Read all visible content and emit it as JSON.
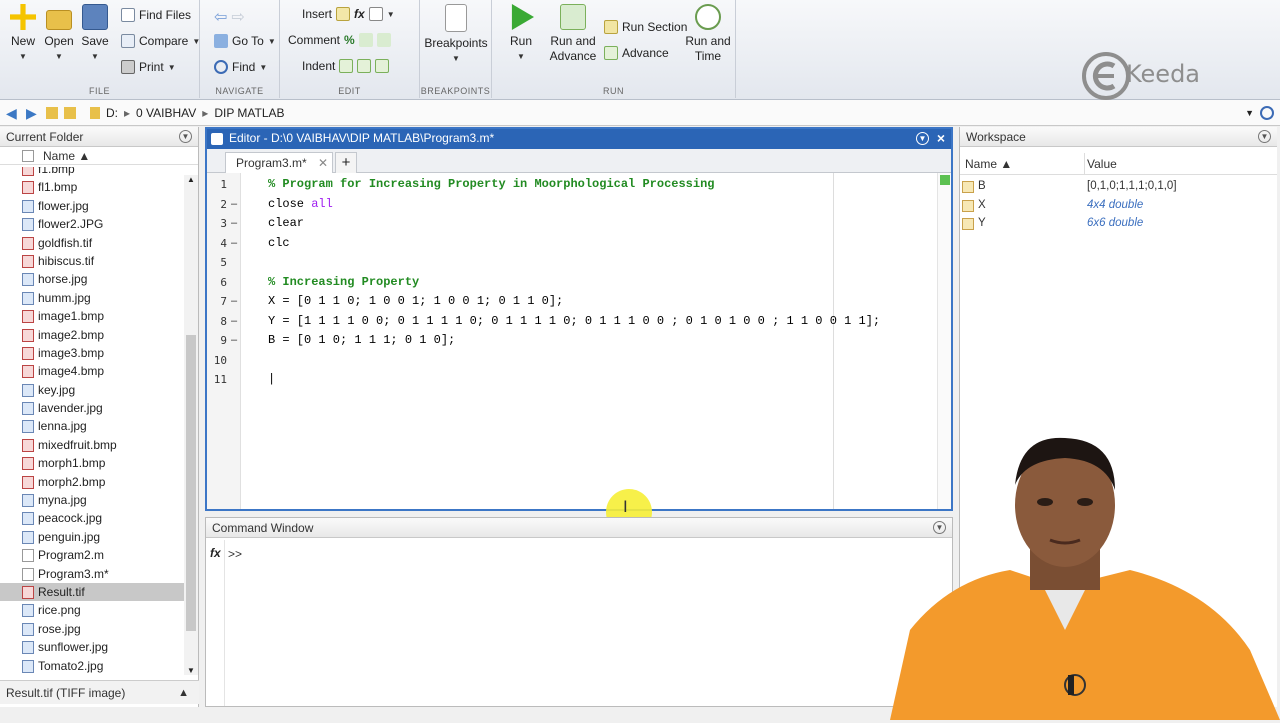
{
  "ribbon": {
    "file": {
      "new": "New",
      "open": "Open",
      "save": "Save",
      "find_files": "Find Files",
      "compare": "Compare",
      "print": "Print",
      "title": "FILE"
    },
    "navigate": {
      "go_to": "Go To",
      "find": "Find",
      "title": "NAVIGATE"
    },
    "edit": {
      "insert": "Insert",
      "comment": "Comment",
      "indent": "Indent",
      "title": "EDIT"
    },
    "breakpoints": {
      "label": "Breakpoints",
      "title": "BREAKPOINTS"
    },
    "run": {
      "run": "Run",
      "run_and_advance": "Run and\nAdvance",
      "run_section": "Run Section",
      "advance": "Advance",
      "run_and_time": "Run and\nTime",
      "title": "RUN"
    }
  },
  "address": {
    "crumbs": [
      "D:",
      "0 VAIBHAV",
      "DIP MATLAB"
    ]
  },
  "current_folder": {
    "title": "Current Folder",
    "column": "Name ▲",
    "files": [
      {
        "name": "f1.bmp",
        "type": "b"
      },
      {
        "name": "fl1.bmp",
        "type": "b"
      },
      {
        "name": "flower.jpg",
        "type": "i"
      },
      {
        "name": "flower2.JPG",
        "type": "i"
      },
      {
        "name": "goldfish.tif",
        "type": "b"
      },
      {
        "name": "hibiscus.tif",
        "type": "b"
      },
      {
        "name": "horse.jpg",
        "type": "i"
      },
      {
        "name": "humm.jpg",
        "type": "i"
      },
      {
        "name": "image1.bmp",
        "type": "b"
      },
      {
        "name": "image2.bmp",
        "type": "b"
      },
      {
        "name": "image3.bmp",
        "type": "b"
      },
      {
        "name": "image4.bmp",
        "type": "b"
      },
      {
        "name": "key.jpg",
        "type": "i"
      },
      {
        "name": "lavender.jpg",
        "type": "i"
      },
      {
        "name": "lenna.jpg",
        "type": "i"
      },
      {
        "name": "mixedfruit.bmp",
        "type": "b"
      },
      {
        "name": "morph1.bmp",
        "type": "b"
      },
      {
        "name": "morph2.bmp",
        "type": "b"
      },
      {
        "name": "myna.jpg",
        "type": "i"
      },
      {
        "name": "peacock.jpg",
        "type": "i"
      },
      {
        "name": "penguin.jpg",
        "type": "i"
      },
      {
        "name": "Program2.m",
        "type": "m"
      },
      {
        "name": "Program3.m*",
        "type": "m"
      },
      {
        "name": "Result.tif",
        "type": "b",
        "selected": true
      },
      {
        "name": "rice.png",
        "type": "i"
      },
      {
        "name": "rose.jpg",
        "type": "i"
      },
      {
        "name": "sunflower.jpg",
        "type": "i"
      },
      {
        "name": "Tomato2.jpg",
        "type": "i"
      }
    ],
    "status": "Result.tif (TIFF image)"
  },
  "editor": {
    "title": "Editor - D:\\0 VAIBHAV\\DIP MATLAB\\Program3.m*",
    "tab": "Program3.m*",
    "lines": [
      {
        "n": "1",
        "dash": false,
        "parts": [
          {
            "t": "% Program for Increasing Property in Moorphological Processing",
            "c": "cmt"
          }
        ]
      },
      {
        "n": "2",
        "dash": true,
        "parts": [
          {
            "t": "close ",
            "c": ""
          },
          {
            "t": "all",
            "c": "kw"
          }
        ]
      },
      {
        "n": "3",
        "dash": true,
        "parts": [
          {
            "t": "clear",
            "c": ""
          }
        ]
      },
      {
        "n": "4",
        "dash": true,
        "parts": [
          {
            "t": "clc",
            "c": ""
          }
        ]
      },
      {
        "n": "5",
        "dash": false,
        "parts": []
      },
      {
        "n": "6",
        "dash": false,
        "parts": [
          {
            "t": "% Increasing Property",
            "c": "cmt"
          }
        ]
      },
      {
        "n": "7",
        "dash": true,
        "parts": [
          {
            "t": "X = [0 1 1 0; 1 0 0 1; 1 0 0 1; 0 1 1 0];",
            "c": ""
          }
        ]
      },
      {
        "n": "8",
        "dash": true,
        "parts": [
          {
            "t": "Y = [1 1 1 1 0 0; 0 1 1 1 1 0; 0 1 1 1 1 0; 0 1 1 1 0 0 ; 0 1 0 1 0 0 ; 1 1 0 0 1 1];",
            "c": ""
          }
        ]
      },
      {
        "n": "9",
        "dash": true,
        "parts": [
          {
            "t": "B = [0 1 0; 1 1 1; 0 1 0];",
            "c": ""
          }
        ]
      },
      {
        "n": "10",
        "dash": false,
        "parts": []
      },
      {
        "n": "11",
        "dash": false,
        "parts": [
          {
            "t": "|",
            "c": ""
          }
        ]
      }
    ]
  },
  "command_window": {
    "title": "Command Window",
    "fx": "fx",
    "prompt": ">>"
  },
  "workspace": {
    "title": "Workspace",
    "col_name": "Name ▲",
    "col_value": "Value",
    "vars": [
      {
        "name": "B",
        "value": "[0,1,0;1,1,1;0,1,0]",
        "italic": false
      },
      {
        "name": "X",
        "value": "4x4 double",
        "italic": true
      },
      {
        "name": "Y",
        "value": "6x6 double",
        "italic": true
      }
    ]
  },
  "logo": {
    "text": "Keeda"
  },
  "colors": {
    "accent": "#2b65b6",
    "comment": "#228b22",
    "keyword": "#a020f0"
  }
}
